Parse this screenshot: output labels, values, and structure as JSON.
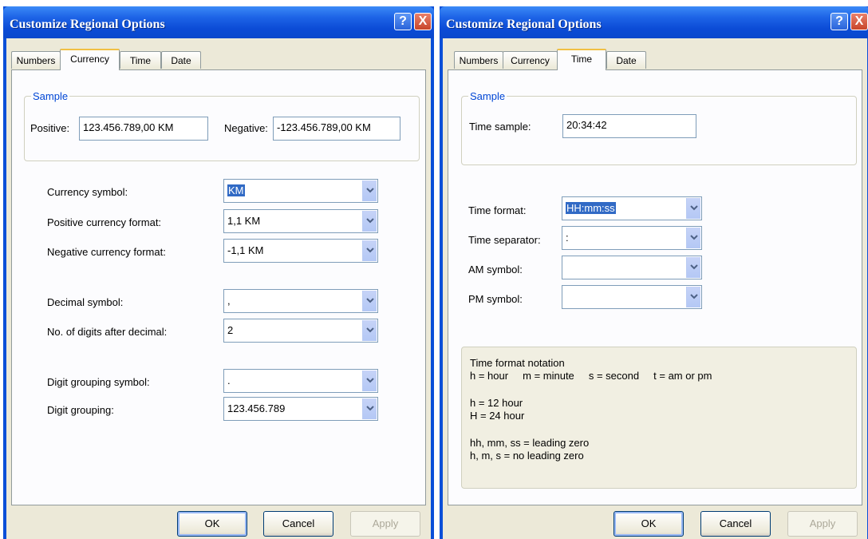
{
  "left_dialog": {
    "title": "Customize Regional Options",
    "help_button": "?",
    "close_button": "X",
    "tabs": [
      {
        "label": "Numbers",
        "active": false
      },
      {
        "label": "Currency",
        "active": true
      },
      {
        "label": "Time",
        "active": false
      },
      {
        "label": "Date",
        "active": false
      }
    ],
    "sample": {
      "legend": "Sample",
      "positive_label": "Positive:",
      "positive_value": "123.456.789,00 KM",
      "negative_label": "Negative:",
      "negative_value": "-123.456.789,00 KM"
    },
    "fields": [
      {
        "label": "Currency symbol:",
        "value": "KM",
        "selected": true
      },
      {
        "label": "Positive currency format:",
        "value": "1,1 KM"
      },
      {
        "label": "Negative currency format:",
        "value": "-1,1 KM"
      },
      {
        "label": "Decimal symbol:",
        "value": ","
      },
      {
        "label": "No. of digits after decimal:",
        "value": "2"
      },
      {
        "label": "Digit grouping symbol:",
        "value": "."
      },
      {
        "label": "Digit grouping:",
        "value": "123.456.789"
      }
    ],
    "buttons": {
      "ok": "OK",
      "cancel": "Cancel",
      "apply": "Apply"
    }
  },
  "right_dialog": {
    "title": "Customize Regional Options",
    "help_button": "?",
    "close_button": "X",
    "tabs": [
      {
        "label": "Numbers",
        "active": false
      },
      {
        "label": "Currency",
        "active": false
      },
      {
        "label": "Time",
        "active": true
      },
      {
        "label": "Date",
        "active": false
      }
    ],
    "sample": {
      "legend": "Sample",
      "time_sample_label": "Time sample:",
      "time_sample_value": "20:34:42"
    },
    "fields": [
      {
        "label": "Time format:",
        "value": "HH:mm:ss",
        "selected": true
      },
      {
        "label": "Time separator:",
        "value": ":"
      },
      {
        "label": "AM symbol:",
        "value": ""
      },
      {
        "label": "PM symbol:",
        "value": ""
      }
    ],
    "notation": {
      "title": "Time format notation",
      "line1": "h = hour     m = minute     s = second     t = am or pm",
      "line2": "h = 12 hour",
      "line3": "H = 24 hour",
      "line4": "hh, mm, ss = leading zero",
      "line5": "h, m, s = no leading zero"
    },
    "buttons": {
      "ok": "OK",
      "cancel": "Cancel",
      "apply": "Apply"
    }
  },
  "icons": {
    "dropdown": "chevron-down-icon"
  },
  "colors": {
    "title_bar": "#0a4fd8",
    "dialog_bg": "#ece9d8",
    "legend": "#0046d5",
    "selection": "#316ac5"
  }
}
